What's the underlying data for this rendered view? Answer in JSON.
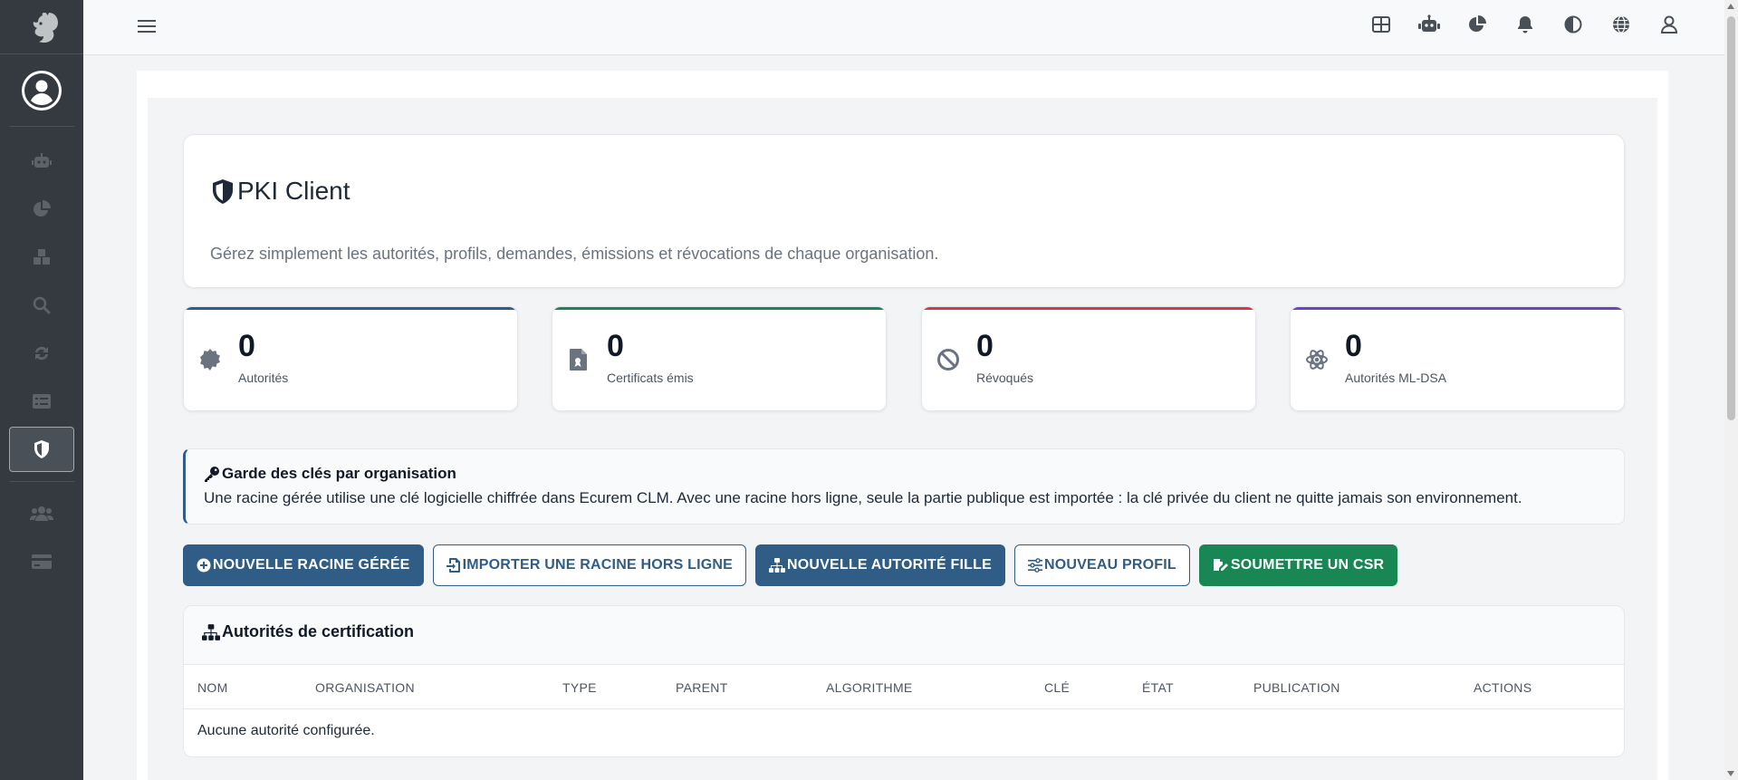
{
  "sidebar": {
    "items": [
      {
        "name": "robot",
        "active": false
      },
      {
        "name": "chart-pie",
        "active": false
      },
      {
        "name": "boxes",
        "active": false
      },
      {
        "name": "search",
        "active": false
      },
      {
        "name": "sync",
        "active": false
      },
      {
        "name": "list",
        "active": false
      },
      {
        "name": "shield",
        "active": true
      },
      {
        "name": "users",
        "active": false
      },
      {
        "name": "card",
        "active": false
      }
    ]
  },
  "topbar": {
    "icons": [
      "grid-icon",
      "robot-icon",
      "chart-pie-icon",
      "bell-icon",
      "contrast-icon",
      "globe-icon",
      "user-icon"
    ]
  },
  "hero": {
    "title": "PKI Client",
    "subtitle": "Gérez simplement les autorités, profils, demandes, émissions et révocations de chaque organisation."
  },
  "stats": [
    {
      "value": "0",
      "label": "Autorités",
      "color": "#2f5d86",
      "icon": "certificate-icon"
    },
    {
      "value": "0",
      "label": "Certificats émis",
      "color": "#198754",
      "icon": "file-certificate-icon"
    },
    {
      "value": "0",
      "label": "Révoqués",
      "color": "#dc3545",
      "icon": "ban-icon"
    },
    {
      "value": "0",
      "label": "Autorités ML-DSA",
      "color": "#6f42c1",
      "icon": "atom-icon"
    }
  ],
  "info": {
    "title": "Garde des clés par organisation",
    "text": "Une racine gérée utilise une clé logicielle chiffrée dans Ecurem CLM. Avec une racine hors ligne, seule la partie publique est importée : la clé privée du client ne quitte jamais son environnement."
  },
  "actions": {
    "new_root": "Nouvelle racine gérée",
    "import_root": "Importer une racine hors ligne",
    "new_sub": "Nouvelle autorité fille",
    "new_profile": "Nouveau profil",
    "submit_csr": "Soumettre un CSR"
  },
  "table": {
    "title": "Autorités de certification",
    "columns": [
      "Nom",
      "Organisation",
      "Type",
      "Parent",
      "Algorithme",
      "Clé",
      "État",
      "Publication",
      "Actions"
    ],
    "empty": "Aucune autorité configurée."
  },
  "colors": {
    "sidebar": "#343a40",
    "primary": "#2f5d86",
    "success": "#198754",
    "danger": "#dc3545",
    "purple": "#6f42c1"
  }
}
